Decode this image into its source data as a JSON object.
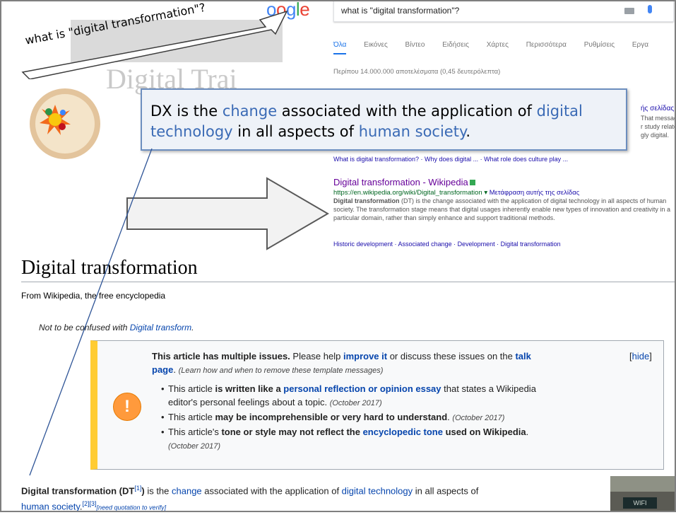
{
  "google": {
    "logo_letters": [
      "o",
      "o",
      "g",
      "l",
      "e"
    ],
    "query": "what is \"digital transformation\"?",
    "tabs": [
      "Όλα",
      "Εικόνες",
      "Βίντεο",
      "Ειδήσεις",
      "Χάρτες",
      "Περισσότερα",
      "Ρυθμίσεις",
      "Εργα"
    ],
    "stats": "Περίπου 14.000.000 αποτελέσματα (0,45 δευτερόλεπτα)",
    "partial_title": "ής σελίδας",
    "partial_lines": [
      "That messag",
      "r study relate",
      "gly digital."
    ],
    "sitelinks": "What is digital transformation? · Why does digital ... · What role does culture play ...",
    "result": {
      "title": "Digital transformation - Wikipedia",
      "url": "https://en.wikipedia.org/wiki/Digital_transformation",
      "arrow": "▾",
      "translate": "Μετάφραση αυτής της σελίδας",
      "desc_bold": "Digital transformation",
      "desc": " (DT) is the change associated with the application of digital technology in all aspects of human society. The transformation stage means that digital usages inherently enable new types of innovation and creativity in a particular domain, rather than simply enhance and support traditional methods."
    },
    "cut_line": "Historic development · Associated change · Development · Digital transformation"
  },
  "slide": {
    "bg_title": "Digital Trai",
    "bubble_text": "what is \"digital transformation\"?",
    "dx": {
      "p1": "DX is the ",
      "k1": "change",
      "p2": " associated with the application of ",
      "k2": "digital technology",
      "p3": " in all aspects of ",
      "k3": "human society",
      "p4": "."
    }
  },
  "wiki": {
    "title": "Digital transformation",
    "from": "From Wikipedia, the free encyclopedia",
    "hatnote_prefix": "Not to be confused with ",
    "hatnote_link": "Digital transform",
    "hatnote_suffix": ".",
    "issues": {
      "bold": "This article has multiple issues.",
      "t1": " Please help ",
      "improve": "improve it",
      "t2": " or discuss these issues on the ",
      "talk": "talk",
      "page": "page",
      "t3": ". ",
      "learn": "(Learn how and when to remove these template messages)",
      "hide": "hide",
      "items": [
        {
          "a": "This article ",
          "b": "is written like a ",
          "link": "personal reflection or opinion essay",
          "c": " that states a Wikipedia",
          "d": "editor's personal feelings about a topic. ",
          "date": "(October 2017)"
        },
        {
          "a": "This article ",
          "b": "may be incomprehensible or very hard to understand",
          "c": ". ",
          "date": "(October 2017)"
        },
        {
          "a": "This article's ",
          "b": "tone or style may not reflect the ",
          "link": "encyclopedic tone",
          "c": " used on Wikipedia",
          "d": ".",
          "date": "(October 2017)"
        }
      ]
    },
    "lead": {
      "bold": "Digital transformation (DT",
      "sup1": "[1]",
      "bold2": ")",
      "t1": " is the ",
      "change": "change",
      "t2": " associated with the application of ",
      "digital_tech": "digital technology",
      "t3": " in all aspects of",
      "human_society": "human society",
      "t4": ".",
      "refs": "[2][3]",
      "verify": "[need quotation to verify]"
    },
    "image_sign": "WIFI"
  }
}
